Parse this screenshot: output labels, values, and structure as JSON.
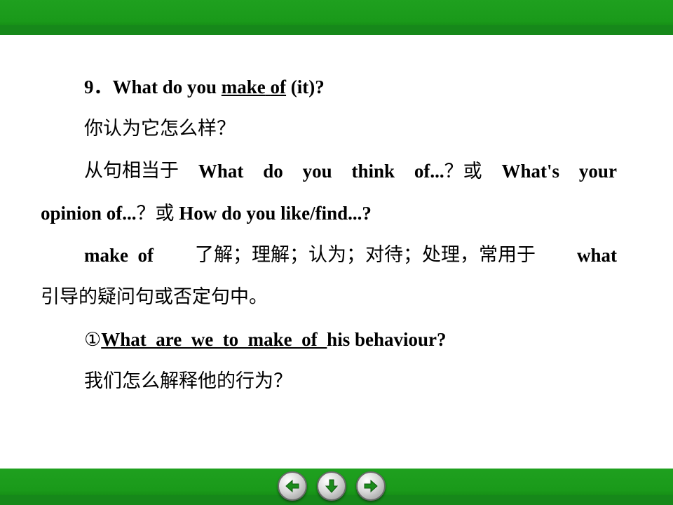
{
  "lines": {
    "l1_num": "9．",
    "l1_pre": "What do you ",
    "l1_u1": "make",
    "l1_u2": "of",
    "l1_post": " (it)?",
    "l2": "你认为它怎么样？",
    "l3_zh": "从句相当于",
    "l3_w1": "What",
    "l3_w2": "do",
    "l3_w3": "you",
    "l3_w4": "think",
    "l3_w5": "of...",
    "l3_q": "？或",
    "l3_w6": "What's",
    "l3_w7": "your",
    "l4_en1": "opinion of...",
    "l4_zh": "？或",
    "l4_en2": "How do you like/find...?",
    "l5_en1": "make",
    "l5_en2": "of",
    "l5_zh": "了解；理解；认为；对待；处理，常用于",
    "l5_en3": "what",
    "l6": "引导的疑问句或否定句中。",
    "l7_circle": "①",
    "l7_u": "What_are_we_to_make_of_",
    "l7_post": "his behaviour?",
    "l8": "我们怎么解释他的行为？"
  },
  "nav": {
    "prev": "left-arrow-icon",
    "down": "down-arrow-icon",
    "next": "right-arrow-icon"
  },
  "colors": {
    "bar_green": "#1a9a1a",
    "icon_green": "#1c8c1c"
  }
}
